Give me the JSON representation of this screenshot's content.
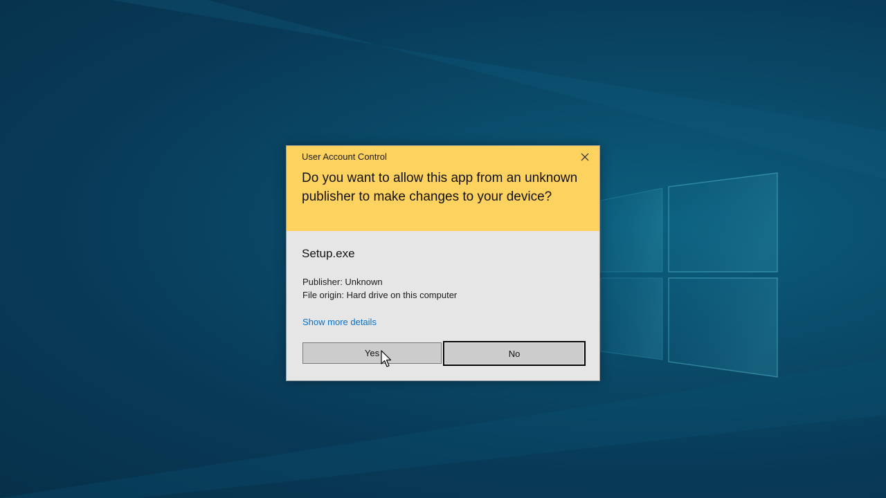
{
  "dialog": {
    "title": "User Account Control",
    "question": "Do you want to allow this app from an unknown publisher to make changes to your device?",
    "app_name": "Setup.exe",
    "publisher": "Publisher: Unknown",
    "file_origin": "File origin: Hard drive on this computer",
    "more_details_link": "Show more details",
    "yes_label": "Yes",
    "no_label": "No",
    "close_icon": "close-icon"
  },
  "colors": {
    "header": "#fed25f",
    "body": "#e6e6e6",
    "link": "#0a6fc2",
    "desktop": "#0a4a69"
  },
  "cursor": {
    "icon": "arrow-cursor-icon"
  }
}
